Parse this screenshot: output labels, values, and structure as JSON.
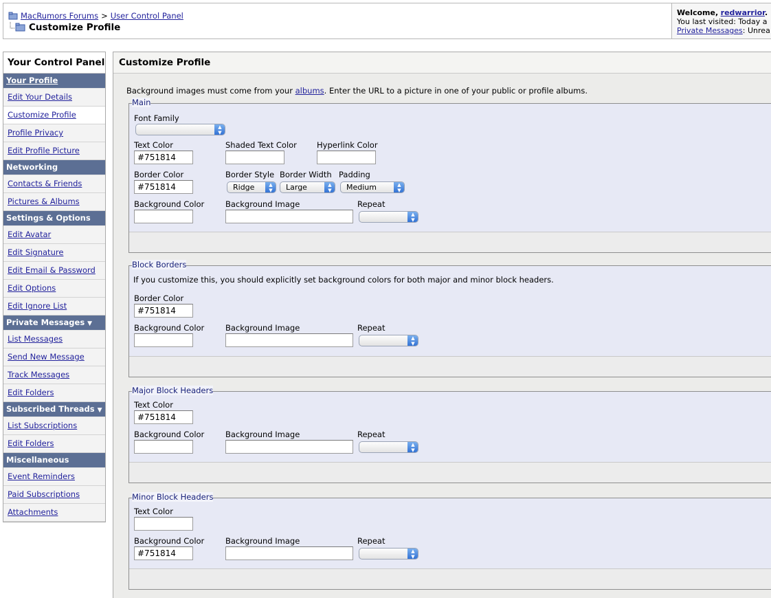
{
  "breadcrumb": {
    "forums": "MacRumors Forums",
    "separator": ">",
    "control_panel": "User Control Panel",
    "current": "Customize Profile"
  },
  "welcome": {
    "prefix": "Welcome,",
    "username": "redwarrior",
    "suffix": ".",
    "last_visited": "You last visited: Today a",
    "pm_link": "Private Messages",
    "pm_suffix": ": Unrea"
  },
  "sidebar": {
    "title": "Your Control Panel",
    "sections": [
      {
        "heading": "Your Profile",
        "items": [
          "Edit Your Details",
          "Customize Profile",
          "Profile Privacy",
          "Edit Profile Picture"
        ]
      },
      {
        "heading": "Networking",
        "items": [
          "Contacts & Friends",
          "Pictures & Albums"
        ]
      },
      {
        "heading": "Settings & Options",
        "items": [
          "Edit Avatar",
          "Edit Signature",
          "Edit Email & Password",
          "Edit Options",
          "Edit Ignore List"
        ]
      },
      {
        "heading": "Private Messages",
        "items": [
          "List Messages",
          "Send New Message",
          "Track Messages",
          "Edit Folders"
        ]
      },
      {
        "heading": "Subscribed Threads",
        "items": [
          "List Subscriptions",
          "Edit Folders"
        ]
      },
      {
        "heading": "Miscellaneous",
        "items": [
          "Event Reminders",
          "Paid Subscriptions",
          "Attachments"
        ]
      }
    ]
  },
  "main": {
    "title": "Customize Profile",
    "intro_before": "Background images must come from your ",
    "intro_link": "albums",
    "intro_after": ". Enter the URL to a picture in one of your public or profile albums."
  },
  "main_set": {
    "legend": "Main",
    "font_family_label": "Font Family",
    "font_family_value": "",
    "text_color_label": "Text Color",
    "text_color_value": "#751814",
    "shaded_text_color_label": "Shaded Text Color",
    "shaded_text_color_value": "",
    "hyperlink_color_label": "Hyperlink Color",
    "hyperlink_color_value": "",
    "border_color_label": "Border Color",
    "border_color_value": "#751814",
    "border_style_label": "Border Style",
    "border_style_value": "Ridge",
    "border_width_label": "Border Width",
    "border_width_value": "Large",
    "padding_label": "Padding",
    "padding_value": "Medium",
    "bg_color_label": "Background Color",
    "bg_color_value": "",
    "bg_image_label": "Background Image",
    "bg_image_value": "",
    "repeat_label": "Repeat",
    "repeat_value": ""
  },
  "block_borders": {
    "legend": "Block Borders",
    "note": "If you customize this, you should explicitly set background colors for both major and minor block headers.",
    "border_color_label": "Border Color",
    "border_color_value": "#751814",
    "bg_color_label": "Background Color",
    "bg_color_value": "",
    "bg_image_label": "Background Image",
    "bg_image_value": "",
    "repeat_label": "Repeat",
    "repeat_value": ""
  },
  "major_headers": {
    "legend": "Major Block Headers",
    "text_color_label": "Text Color",
    "text_color_value": "#751814",
    "bg_color_label": "Background Color",
    "bg_color_value": "",
    "bg_image_label": "Background Image",
    "bg_image_value": "",
    "repeat_label": "Repeat",
    "repeat_value": ""
  },
  "minor_headers": {
    "legend": "Minor Block Headers",
    "text_color_label": "Text Color",
    "text_color_value": "",
    "bg_color_label": "Background Color",
    "bg_color_value": "#751814",
    "bg_image_label": "Background Image",
    "bg_image_value": "",
    "repeat_label": "Repeat",
    "repeat_value": ""
  },
  "colors": {
    "sidebar_heading_bg": "#5c6f94",
    "link": "#22229c",
    "fieldset_bg": "#e7e9f5",
    "legend_text": "#1a237a"
  },
  "icons": {
    "forum_icon": "folder-icon",
    "tree_icon": "tree-folder-icon",
    "select_arrow": "updown-arrows-icon",
    "dropdown_triangle": "triangle-down-icon"
  }
}
